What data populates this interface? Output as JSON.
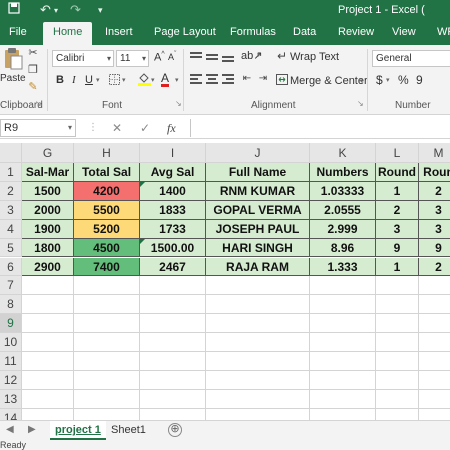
{
  "window": {
    "title": "Project 1 - Excel ("
  },
  "quick_access": {
    "icons": [
      "save-icon",
      "undo-icon",
      "redo-icon",
      "customize-icon"
    ]
  },
  "ribbon_tabs": [
    "File",
    "Home",
    "Insert",
    "Page Layout",
    "Formulas",
    "Data",
    "Review",
    "View",
    "WP"
  ],
  "active_tab": "Home",
  "clipboard": {
    "paste_label": "Paste",
    "group_label": "Clipboard"
  },
  "font": {
    "name": "Calibri",
    "size": "11",
    "grow": "A",
    "shrink": "A",
    "bold": "B",
    "italic": "I",
    "underline": "U",
    "font_color": "A",
    "group_label": "Font"
  },
  "alignment": {
    "wrap_text_label": "Wrap Text",
    "merge_label": "Merge & Center",
    "group_label": "Alignment"
  },
  "number": {
    "format": "General",
    "currency": "$",
    "percent": "%",
    "comma": "9",
    "group_label": "Number"
  },
  "formula_bar": {
    "name_box": "R9",
    "cancel": "✕",
    "enter": "✓",
    "fx": "fx",
    "value": ""
  },
  "columns": [
    "G",
    "H",
    "I",
    "J",
    "K",
    "L",
    "M"
  ],
  "rows": [
    "1",
    "2",
    "3",
    "4",
    "5",
    "6",
    "7",
    "8",
    "9",
    "10",
    "11",
    "12",
    "13",
    "14"
  ],
  "headers": [
    "Sal-Mar",
    "Total Sal",
    "Avg Sal",
    "Full Name",
    "Numbers",
    "Round",
    "Roun"
  ],
  "table_rows": [
    [
      "1500",
      "4200",
      "1400",
      "RNM  KUMAR",
      "1.03333",
      "1",
      "2"
    ],
    [
      "2000",
      "5500",
      "1833",
      "GOPAL  VERMA",
      "2.0555",
      "2",
      "3"
    ],
    [
      "1900",
      "5200",
      "1733",
      "JOSEPH  PAUL",
      "2.999",
      "3",
      "3"
    ],
    [
      "1800",
      "4500",
      "1500.00",
      "HARI  SINGH",
      "8.96",
      "9",
      "9"
    ],
    [
      "2900",
      "7400",
      "2467",
      "RAJA  RAM",
      "1.333",
      "1",
      "2"
    ]
  ],
  "conditional_fills": [
    "#f4706f",
    "#fed978",
    "#fed978",
    "#63be7b",
    "#63be7b"
  ],
  "colors": {
    "excel_green": "#217346",
    "header_fill": "#d6ecd1"
  },
  "sheets": [
    "project 1",
    "Sheet1"
  ],
  "active_sheet": "project 1",
  "add_sheet_icon": "⊕",
  "status": {
    "text": "Ready"
  }
}
